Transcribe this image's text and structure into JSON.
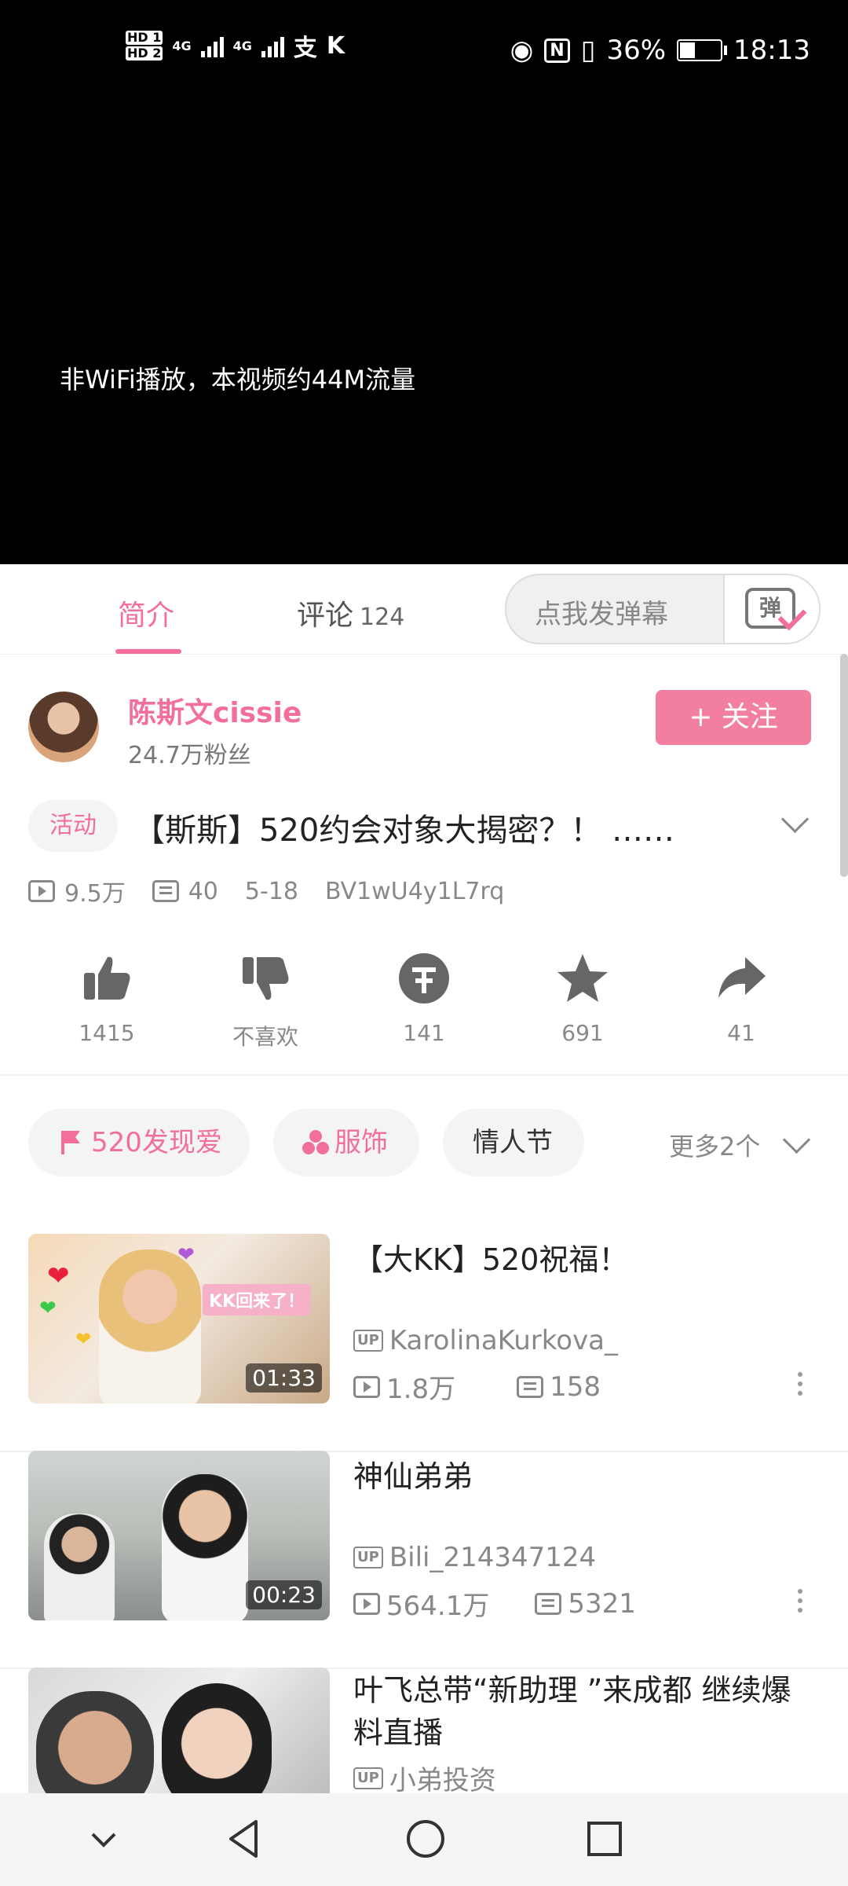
{
  "status_bar": {
    "hd1": "HD 1",
    "hd2": "HD 2",
    "net1": "4G",
    "net2": "4G",
    "battery": "36%",
    "time": "18:13"
  },
  "video": {
    "notice": "非WiFi播放，本视频约44M流量"
  },
  "tabs": {
    "intro": "简介",
    "comments": "评论",
    "comments_count": "124"
  },
  "danmaku": {
    "placeholder": "点我发弹幕",
    "button_glyph": "弹"
  },
  "uploader": {
    "name": "陈斯文cissie",
    "fans": "24.7万粉丝",
    "follow": "+ 关注"
  },
  "video_info": {
    "tag": "活动",
    "title": "【斯斯】520约会对象大揭密？！ ……",
    "views": "9.5万",
    "danmaku_count": "40",
    "date": "5-18",
    "bvid": "BV1wU4y1L7rq"
  },
  "actions": {
    "like": "1415",
    "dislike": "不喜欢",
    "coin": "141",
    "favorite": "691",
    "share": "41"
  },
  "tag_chips": [
    {
      "label": "520发现爱",
      "color": "#f26f99"
    },
    {
      "label": "服饰",
      "color": "#f26f99"
    },
    {
      "label": "情人节",
      "color": "#333333"
    }
  ],
  "more_tags": "更多2个",
  "recommendations": [
    {
      "title": "【大KK】520祝福！",
      "up": "KarolinaKurkova_",
      "views": "1.8万",
      "danmaku": "158",
      "duration": "01:33",
      "thumb_text": "KK回来了！"
    },
    {
      "title": "神仙弟弟",
      "up": "Bili_214347124",
      "views": "564.1万",
      "danmaku": "5321",
      "duration": "00:23"
    },
    {
      "title": "叶飞总带“新助理 ”来成都 继续爆料直播",
      "up": "小弟投资"
    }
  ],
  "colors": {
    "accent": "#f26f99",
    "follow_bg": "#f27ea0"
  }
}
